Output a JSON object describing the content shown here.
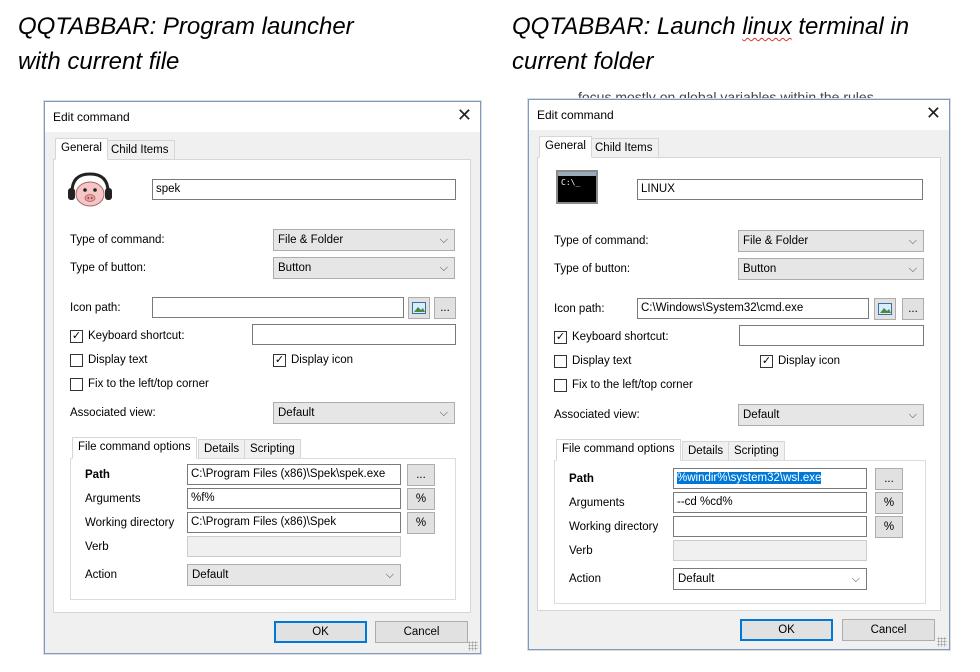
{
  "captions": {
    "left": {
      "line1": "QQTABBAR: Program launcher",
      "line2": "with current file"
    },
    "right": {
      "line1_pre": "QQTABBAR: Launch ",
      "line1_squiggle": "linux",
      "line1_post": " terminal in",
      "line2": "current folder"
    }
  },
  "background_text": "focus mostly on global variables within the rules",
  "dialog_left": {
    "title": "Edit command",
    "close": "✕",
    "tabs": [
      "General",
      "Child Items"
    ],
    "name_value": "spek",
    "type_of_command_label": "Type of command:",
    "type_of_command_value": "File & Folder",
    "type_of_button_label": "Type of button:",
    "type_of_button_value": "Button",
    "icon_path_label": "Icon path:",
    "icon_path_value": "",
    "browse_label": "...",
    "keyboard_shortcut_label": "Keyboard shortcut:",
    "keyboard_shortcut_value": "",
    "display_text_label": "Display text",
    "display_icon_label": "Display icon",
    "fix_corner_label": "Fix to the left/top corner",
    "associated_view_label": "Associated view:",
    "associated_view_value": "Default",
    "sub_tabs": [
      "File command options",
      "Details",
      "Scripting"
    ],
    "path_label": "Path",
    "path_value": "C:\\Program Files (x86)\\Spek\\spek.exe",
    "arguments_label": "Arguments",
    "arguments_value": "%f%",
    "working_dir_label": "Working directory",
    "working_dir_value": "C:\\Program Files (x86)\\Spek",
    "verb_label": "Verb",
    "action_label": "Action",
    "action_value": "Default",
    "percent_label": "%",
    "ok_label": "OK",
    "cancel_label": "Cancel",
    "keyboard_shortcut_checked": true,
    "display_text_checked": false,
    "display_icon_checked": true,
    "fix_corner_checked": false
  },
  "dialog_right": {
    "title": "Edit command",
    "close": "✕",
    "tabs": [
      "General",
      "Child Items"
    ],
    "name_value": "LINUX",
    "terminal_glyph": "C:\\_",
    "type_of_command_label": "Type of command:",
    "type_of_command_value": "File & Folder",
    "type_of_button_label": "Type of button:",
    "type_of_button_value": "Button",
    "icon_path_label": "Icon path:",
    "icon_path_value": "C:\\Windows\\System32\\cmd.exe",
    "browse_label": "...",
    "keyboard_shortcut_label": "Keyboard shortcut:",
    "keyboard_shortcut_value": "",
    "display_text_label": "Display text",
    "display_icon_label": "Display icon",
    "fix_corner_label": "Fix to the left/top corner",
    "associated_view_label": "Associated view:",
    "associated_view_value": "Default",
    "sub_tabs": [
      "File command options",
      "Details",
      "Scripting"
    ],
    "path_label": "Path",
    "path_value": "%windir%\\system32\\wsl.exe",
    "arguments_label": "Arguments",
    "arguments_value": "--cd %cd%",
    "working_dir_label": "Working directory",
    "working_dir_value": "",
    "verb_label": "Verb",
    "action_label": "Action",
    "action_value": "Default",
    "percent_label": "%",
    "ok_label": "OK",
    "cancel_label": "Cancel",
    "keyboard_shortcut_checked": true,
    "display_text_checked": false,
    "display_icon_checked": true,
    "fix_corner_checked": false
  },
  "colors": {
    "accent": "#0078d7",
    "dialog_bg": "#f0f0f0",
    "window_border": "#7a9cc4"
  }
}
